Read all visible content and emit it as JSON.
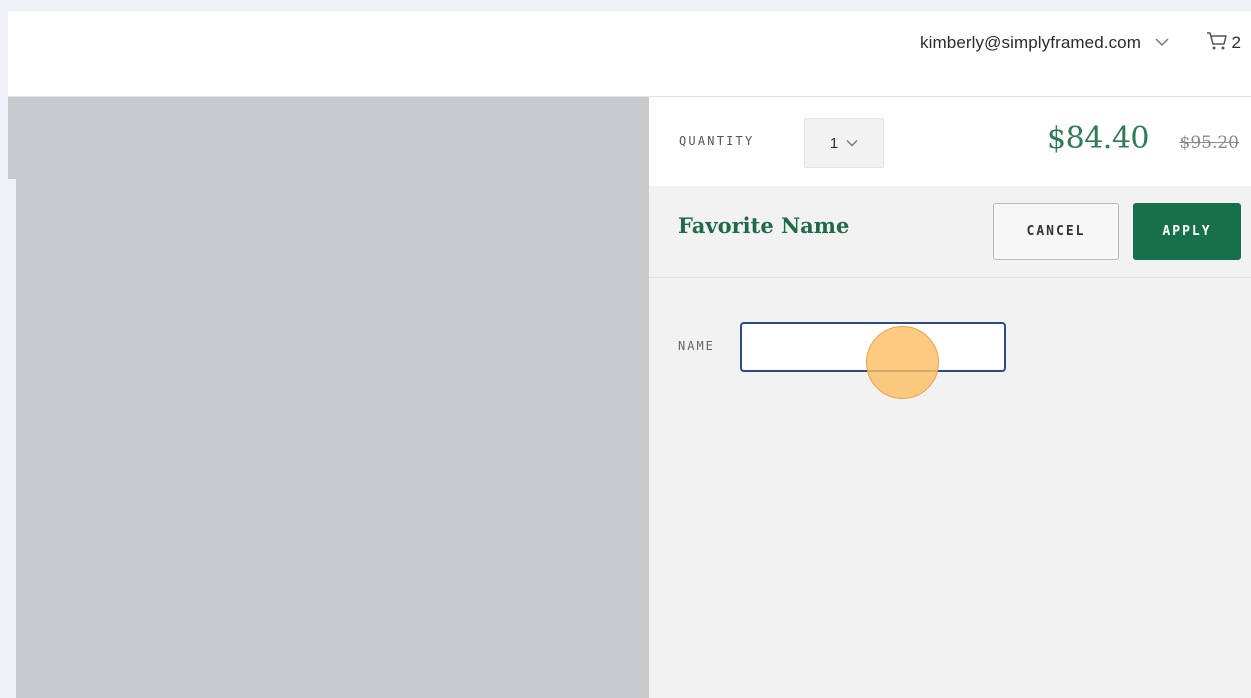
{
  "header": {
    "account_email": "kimberly@simplyframed.com",
    "cart_count": "2"
  },
  "product": {
    "quantity_label": "QUANTITY",
    "quantity_value": "1",
    "price_current": "$84.40",
    "price_original": "$95.20",
    "price_current_color": "#2f7a57"
  },
  "option_panel": {
    "title": "Favorite Name",
    "cancel_label": "CANCEL",
    "apply_label": "APPLY",
    "apply_color": "#16704a",
    "name_label": "NAME",
    "name_value": "",
    "name_placeholder": ""
  },
  "icons": {
    "account_dropdown": "chevron-down-icon",
    "quantity_dropdown": "chevron-down-icon",
    "cart": "cart-icon"
  }
}
